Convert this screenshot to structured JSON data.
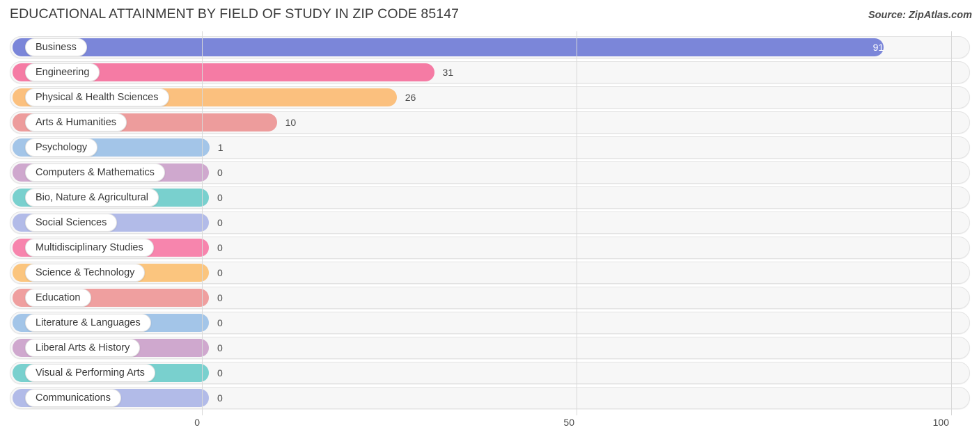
{
  "header": {
    "title": "EDUCATIONAL ATTAINMENT BY FIELD OF STUDY IN ZIP CODE 85147",
    "source": "Source: ZipAtlas.com"
  },
  "chart_data": {
    "type": "bar",
    "orientation": "horizontal",
    "title": "EDUCATIONAL ATTAINMENT BY FIELD OF STUDY IN ZIP CODE 85147",
    "xlabel": "",
    "ylabel": "",
    "xlim": [
      0,
      100
    ],
    "xticks": [
      "0",
      "50",
      "100"
    ],
    "xtick_values": [
      0,
      50,
      100
    ],
    "grid": true,
    "legend": false,
    "categories": [
      "Business",
      "Engineering",
      "Physical & Health Sciences",
      "Arts & Humanities",
      "Psychology",
      "Computers & Mathematics",
      "Bio, Nature & Agricultural",
      "Social Sciences",
      "Multidisciplinary Studies",
      "Science & Technology",
      "Education",
      "Literature & Languages",
      "Liberal Arts & History",
      "Visual & Performing Arts",
      "Communications"
    ],
    "values": [
      91,
      31,
      26,
      10,
      1,
      0,
      0,
      0,
      0,
      0,
      0,
      0,
      0,
      0,
      0
    ],
    "value_labels": [
      "91",
      "31",
      "26",
      "10",
      "1",
      "0",
      "0",
      "0",
      "0",
      "0",
      "0",
      "0",
      "0",
      "0",
      "0"
    ],
    "colors": [
      "#7b86d9",
      "#f57ba4",
      "#fbc07e",
      "#ed9c9c",
      "#a3c5e8",
      "#cfa8ce",
      "#79d0ce",
      "#b2bbe8",
      "#f785ad",
      "#fbc57e",
      "#ef9f9f",
      "#a3c5e8",
      "#cfa8ce",
      "#79d0ce",
      "#b2bbe8"
    ]
  }
}
